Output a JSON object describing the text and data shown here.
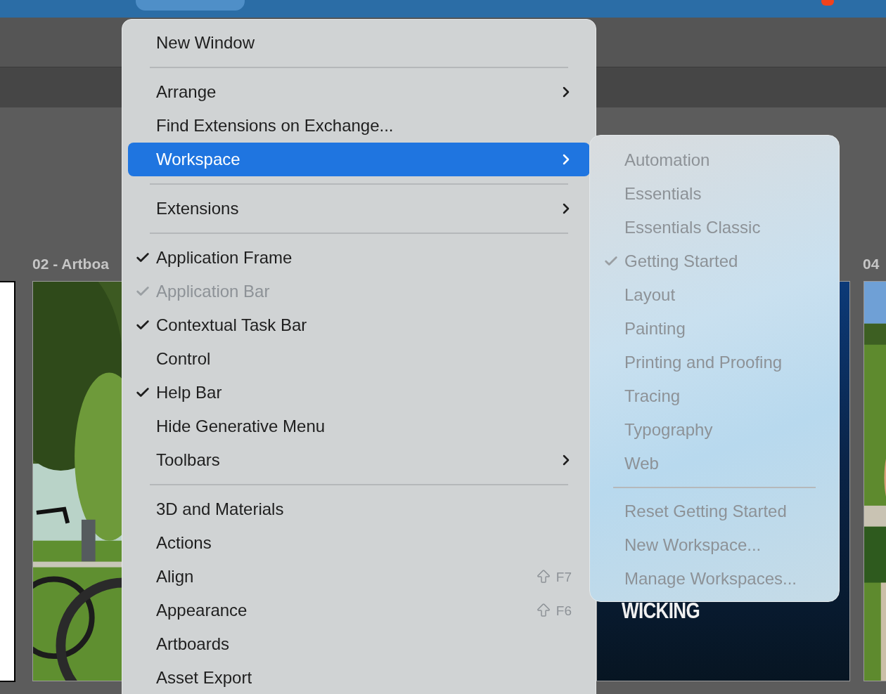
{
  "canvas": {
    "artboards": [
      {
        "label": "02 - Artboa",
        "kind": "picture"
      },
      {
        "label": "04",
        "kind": "picture"
      }
    ],
    "poster_text": "WICKING"
  },
  "window_menu": {
    "items": [
      {
        "kind": "item",
        "label": "New Window",
        "checked": false,
        "disabled": false,
        "submenu": false,
        "selected": false
      },
      {
        "kind": "separator"
      },
      {
        "kind": "item",
        "label": "Arrange",
        "checked": false,
        "disabled": false,
        "submenu": true,
        "selected": false
      },
      {
        "kind": "item",
        "label": "Find Extensions on Exchange...",
        "checked": false,
        "disabled": false,
        "submenu": false,
        "selected": false
      },
      {
        "kind": "item",
        "label": "Workspace",
        "checked": false,
        "disabled": false,
        "submenu": true,
        "selected": true
      },
      {
        "kind": "separator"
      },
      {
        "kind": "item",
        "label": "Extensions",
        "checked": false,
        "disabled": false,
        "submenu": true,
        "selected": false
      },
      {
        "kind": "separator"
      },
      {
        "kind": "item",
        "label": "Application Frame",
        "checked": true,
        "disabled": false,
        "submenu": false,
        "selected": false
      },
      {
        "kind": "item",
        "label": "Application Bar",
        "checked": true,
        "disabled": true,
        "submenu": false,
        "selected": false
      },
      {
        "kind": "item",
        "label": "Contextual Task Bar",
        "checked": true,
        "disabled": false,
        "submenu": false,
        "selected": false
      },
      {
        "kind": "item",
        "label": "Control",
        "checked": false,
        "disabled": false,
        "submenu": false,
        "selected": false
      },
      {
        "kind": "item",
        "label": "Help Bar",
        "checked": true,
        "disabled": false,
        "submenu": false,
        "selected": false
      },
      {
        "kind": "item",
        "label": "Hide Generative Menu",
        "checked": false,
        "disabled": false,
        "submenu": false,
        "selected": false
      },
      {
        "kind": "item",
        "label": "Toolbars",
        "checked": false,
        "disabled": false,
        "submenu": true,
        "selected": false
      },
      {
        "kind": "separator"
      },
      {
        "kind": "item",
        "label": "3D and Materials",
        "checked": false,
        "disabled": false,
        "submenu": false,
        "selected": false
      },
      {
        "kind": "item",
        "label": "Actions",
        "checked": false,
        "disabled": false,
        "submenu": false,
        "selected": false
      },
      {
        "kind": "item",
        "label": "Align",
        "checked": false,
        "disabled": false,
        "submenu": false,
        "selected": false,
        "shortcut": "F7"
      },
      {
        "kind": "item",
        "label": "Appearance",
        "checked": false,
        "disabled": false,
        "submenu": false,
        "selected": false,
        "shortcut": "F6"
      },
      {
        "kind": "item",
        "label": "Artboards",
        "checked": false,
        "disabled": false,
        "submenu": false,
        "selected": false
      },
      {
        "kind": "item",
        "label": "Asset Export",
        "checked": false,
        "disabled": false,
        "submenu": false,
        "selected": false
      }
    ]
  },
  "workspace_submenu": {
    "items": [
      {
        "kind": "item",
        "label": "Automation",
        "checked": false,
        "disabled": true
      },
      {
        "kind": "item",
        "label": "Essentials",
        "checked": false,
        "disabled": true
      },
      {
        "kind": "item",
        "label": "Essentials Classic",
        "checked": false,
        "disabled": true
      },
      {
        "kind": "item",
        "label": "Getting Started",
        "checked": true,
        "disabled": true
      },
      {
        "kind": "item",
        "label": "Layout",
        "checked": false,
        "disabled": true
      },
      {
        "kind": "item",
        "label": "Painting",
        "checked": false,
        "disabled": true
      },
      {
        "kind": "item",
        "label": "Printing and Proofing",
        "checked": false,
        "disabled": true
      },
      {
        "kind": "item",
        "label": "Tracing",
        "checked": false,
        "disabled": true
      },
      {
        "kind": "item",
        "label": "Typography",
        "checked": false,
        "disabled": true
      },
      {
        "kind": "item",
        "label": "Web",
        "checked": false,
        "disabled": true
      },
      {
        "kind": "separator"
      },
      {
        "kind": "item",
        "label": "Reset Getting Started",
        "checked": false,
        "disabled": true
      },
      {
        "kind": "item",
        "label": "New Workspace...",
        "checked": false,
        "disabled": true
      },
      {
        "kind": "item",
        "label": "Manage Workspaces...",
        "checked": false,
        "disabled": true
      }
    ]
  }
}
